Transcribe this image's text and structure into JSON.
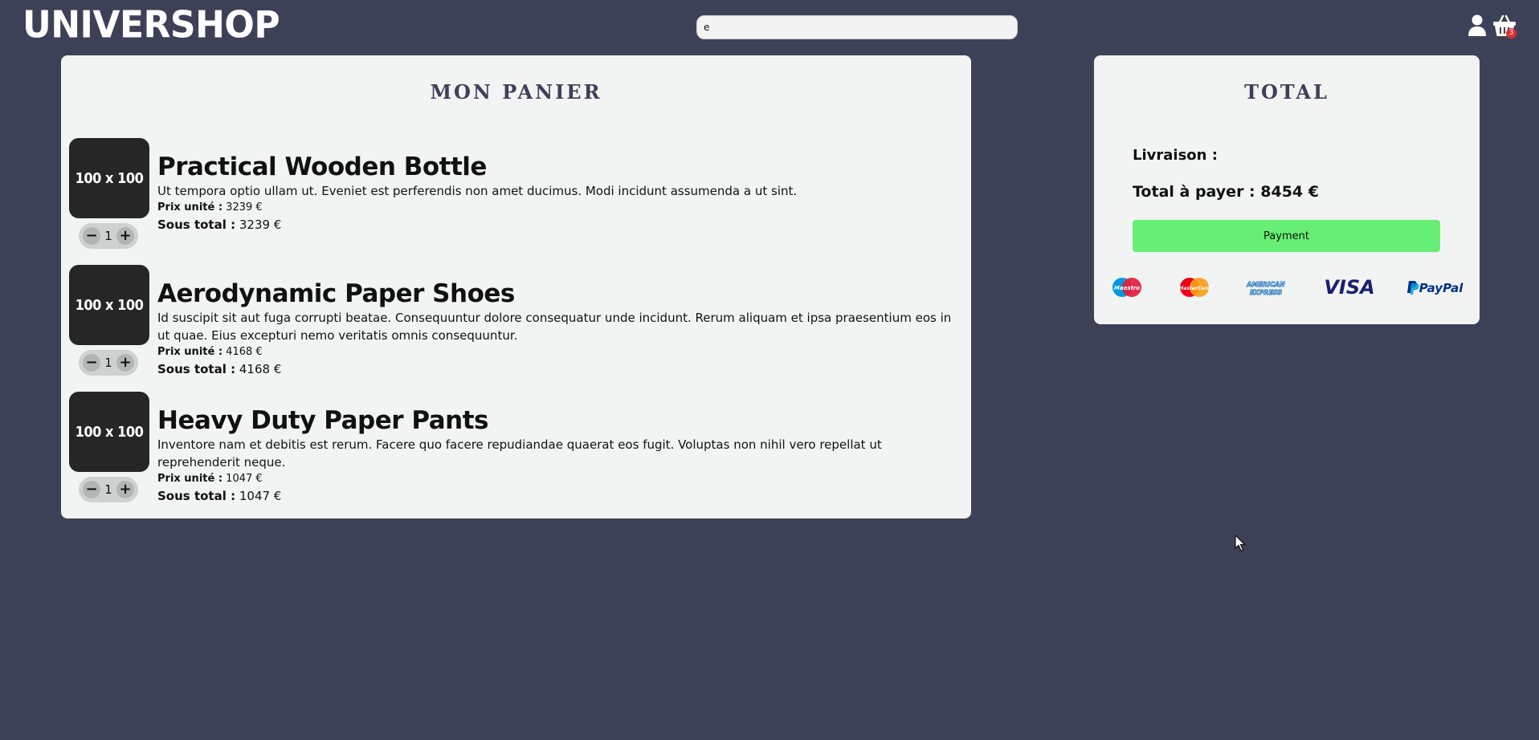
{
  "header": {
    "logo": "UNIVERSHOP",
    "search_value": "e",
    "cart_count": "3"
  },
  "cart": {
    "title": "MON PANIER",
    "unit_label": "Prix unité :",
    "subtotal_label": "Sous total :",
    "items": [
      {
        "thumb": "100 x 100",
        "name": "Practical Wooden Bottle",
        "description": "Ut tempora optio ullam ut. Eveniet est perferendis non amet ducimus. Modi incidunt assumenda a ut sint.",
        "unit_price": "3239 €",
        "subtotal": "3239 €",
        "quantity": "1"
      },
      {
        "thumb": "100 x 100",
        "name": "Aerodynamic Paper Shoes",
        "description": "Id suscipit sit aut fuga corrupti beatae. Consequuntur dolore consequatur unde incidunt. Rerum aliquam et ipsa praesentium eos in ut quae. Eius excepturi nemo veritatis omnis consequuntur.",
        "unit_price": "4168 €",
        "subtotal": "4168 €",
        "quantity": "1"
      },
      {
        "thumb": "100 x 100",
        "name": "Heavy Duty Paper Pants",
        "description": "Inventore nam et debitis est rerum. Facere quo facere repudiandae quaerat eos fugit. Voluptas non nihil vero repellat ut reprehenderit neque.",
        "unit_price": "1047 €",
        "subtotal": "1047 €",
        "quantity": "1"
      }
    ]
  },
  "total": {
    "title": "TOTAL",
    "delivery_label": "Livraison :",
    "total_label": "Total à payer : 8454 €",
    "pay_button": "Payment",
    "payment_methods": [
      "Maestro",
      "MasterCard",
      "AMERICAN EXPRESS",
      "VISA",
      "PayPal"
    ]
  },
  "colors": {
    "background": "#3d4157",
    "panel": "#f2f4f3",
    "pay_button": "#66ef74",
    "badge": "#d93030"
  }
}
